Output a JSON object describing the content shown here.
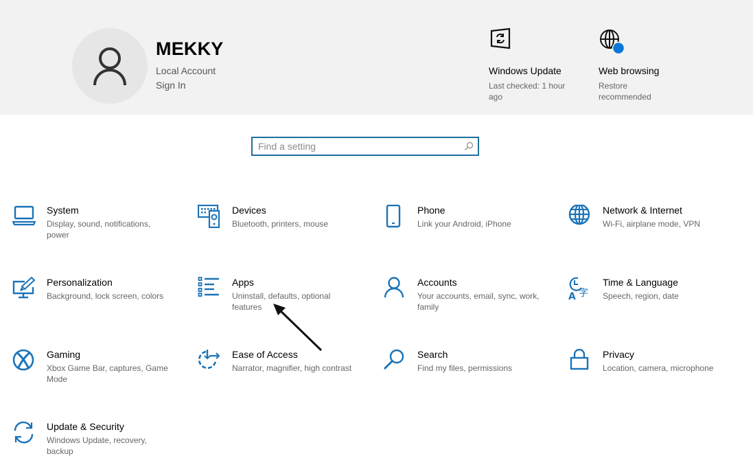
{
  "header": {
    "user": {
      "name": "MEKKY",
      "account_type": "Local Account",
      "sign_in_label": "Sign In"
    },
    "tiles": [
      {
        "id": "windows-update",
        "title": "Windows Update",
        "desc": "Last checked: 1 hour ago",
        "icon": "windows-update-icon"
      },
      {
        "id": "web-browsing",
        "title": "Web browsing",
        "desc": "Restore recommended",
        "icon": "globe-alert-icon"
      }
    ]
  },
  "search": {
    "placeholder": "Find a setting",
    "value": ""
  },
  "settings": [
    {
      "id": "system",
      "title": "System",
      "desc": "Display, sound, notifications, power",
      "icon": "laptop-icon"
    },
    {
      "id": "devices",
      "title": "Devices",
      "desc": "Bluetooth, printers, mouse",
      "icon": "devices-icon"
    },
    {
      "id": "phone",
      "title": "Phone",
      "desc": "Link your Android, iPhone",
      "icon": "phone-icon"
    },
    {
      "id": "network",
      "title": "Network & Internet",
      "desc": "Wi-Fi, airplane mode, VPN",
      "icon": "globe-icon"
    },
    {
      "id": "personalization",
      "title": "Personalization",
      "desc": "Background, lock screen, colors",
      "icon": "paintbrush-monitor-icon"
    },
    {
      "id": "apps",
      "title": "Apps",
      "desc": "Uninstall, defaults, optional features",
      "icon": "apps-list-icon"
    },
    {
      "id": "accounts",
      "title": "Accounts",
      "desc": "Your accounts, email, sync, work, family",
      "icon": "person-icon"
    },
    {
      "id": "time-language",
      "title": "Time & Language",
      "desc": "Speech, region, date",
      "icon": "time-language-icon"
    },
    {
      "id": "gaming",
      "title": "Gaming",
      "desc": "Xbox Game Bar, captures, Game Mode",
      "icon": "xbox-icon"
    },
    {
      "id": "ease-of-access",
      "title": "Ease of Access",
      "desc": "Narrator, magnifier, high contrast",
      "icon": "ease-of-access-icon"
    },
    {
      "id": "search",
      "title": "Search",
      "desc": "Find my files, permissions",
      "icon": "magnifier-icon"
    },
    {
      "id": "privacy",
      "title": "Privacy",
      "desc": "Location, camera, microphone",
      "icon": "lock-icon"
    },
    {
      "id": "update-security",
      "title": "Update & Security",
      "desc": "Windows Update, recovery, backup",
      "icon": "sync-icon"
    }
  ],
  "colors": {
    "accent": "#1a73b8",
    "header_bg": "#f2f2f2",
    "search_border": "#1f6e9a",
    "badge": "#0a78d7"
  }
}
